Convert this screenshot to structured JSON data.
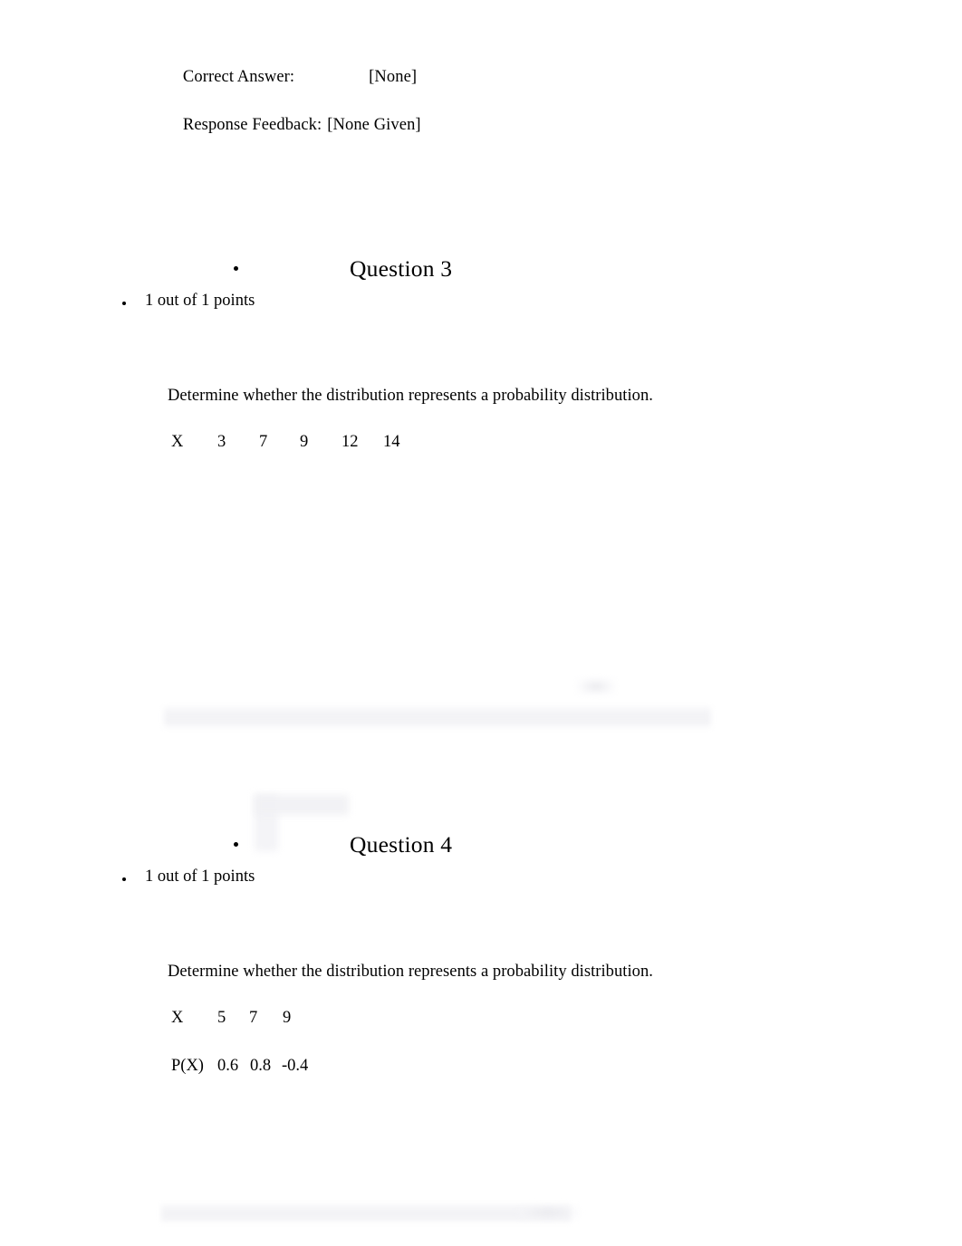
{
  "document": {
    "type": "quiz-review",
    "feedback_block": {
      "correct_answer_label": "Correct Answer:",
      "correct_answer_value": "[None]",
      "response_feedback_label": "Response Feedback:",
      "response_feedback_value": "[None Given]"
    },
    "questions": [
      {
        "title": "Question 3",
        "points": "1 out of 1 points",
        "prompt": "Determine whether the distribution represents a probability distribution.",
        "table": {
          "rows": [
            {
              "label": "X",
              "values": [
                "3",
                "7",
                "9",
                "12",
                "14"
              ]
            }
          ]
        }
      },
      {
        "title": "Question 4",
        "points": "1 out of 1 points",
        "prompt": "Determine whether the distribution represents a probability distribution.",
        "table": {
          "rows": [
            {
              "label": "X",
              "values": [
                "5",
                "7",
                "9"
              ]
            },
            {
              "label": "P(X)",
              "values": [
                "0.6",
                "0.8",
                "-0.4"
              ]
            }
          ]
        }
      }
    ]
  },
  "colors": {
    "page_background": "#ffffff",
    "text": "#000000",
    "artifact_gray": "#f2f2f5"
  }
}
